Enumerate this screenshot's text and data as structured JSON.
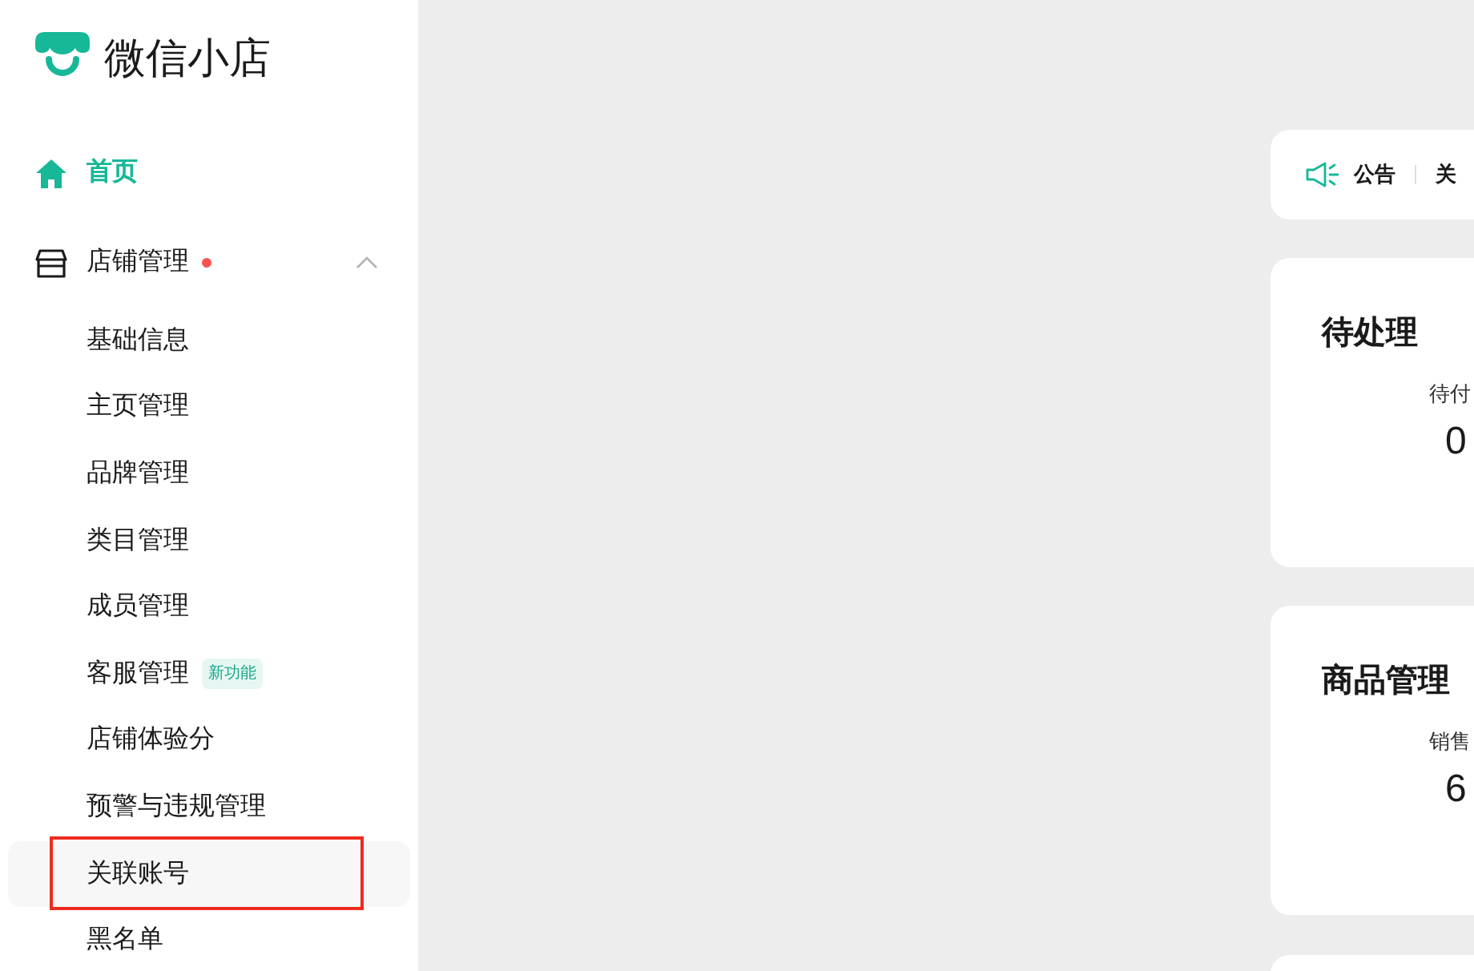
{
  "brand": {
    "name": "微信小店"
  },
  "sidebar": {
    "items": [
      {
        "kind": "home",
        "label": "首页",
        "selected": true
      },
      {
        "kind": "store",
        "label": "店铺管理",
        "dot": true,
        "expanded": true,
        "selected": false,
        "children": [
          {
            "label": "基础信息",
            "selected": false,
            "annotated": false
          },
          {
            "label": "主页管理",
            "selected": false,
            "annotated": false
          },
          {
            "label": "品牌管理",
            "selected": false,
            "annotated": false
          },
          {
            "label": "类目管理",
            "selected": false,
            "annotated": false
          },
          {
            "label": "成员管理",
            "selected": false,
            "annotated": false
          },
          {
            "label": "客服管理",
            "badge": "新功能",
            "selected": false,
            "annotated": false
          },
          {
            "label": "店铺体验分",
            "selected": false,
            "annotated": false
          },
          {
            "label": "预警与违规管理",
            "selected": false,
            "annotated": false
          },
          {
            "label": "关联账号",
            "selected": true,
            "annotated": true
          },
          {
            "label": "黑名单",
            "selected": false,
            "annotated": false
          }
        ]
      }
    ]
  },
  "announcement": {
    "label": "公告",
    "text": "关"
  },
  "cards": [
    {
      "title": "待处理",
      "stats": [
        {
          "label": "待付",
          "value": "0"
        }
      ]
    },
    {
      "title": "商品管理",
      "stats": [
        {
          "label": "销售",
          "value": "6"
        }
      ]
    }
  ]
}
